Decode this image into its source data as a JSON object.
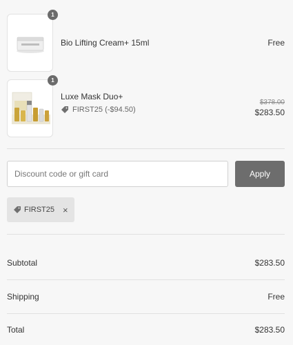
{
  "items": [
    {
      "name": "Bio Lifting Cream+ 15ml",
      "quantity": "1",
      "price": "Free",
      "image_icon": "cream-jar-thumbnail"
    },
    {
      "name": "Luxe Mask Duo+",
      "quantity": "1",
      "discount_label": "FIRST25 (-$94.50)",
      "original_price": "$378.00",
      "price": "$283.50",
      "image_icon": "mask-kit-thumbnail"
    }
  ],
  "discount": {
    "placeholder": "Discount code or gift card",
    "value": "",
    "apply_label": "Apply",
    "applied_code": "FIRST25",
    "remove_icon": "×"
  },
  "summary": {
    "subtotal_label": "Subtotal",
    "subtotal_value": "$283.50",
    "shipping_label": "Shipping",
    "shipping_value": "Free",
    "total_label": "Total",
    "total_value": "$283.50"
  },
  "colors": {
    "background": "#f7f7f7",
    "apply_button": "#6d6d6d",
    "chip_background": "#e4e4e4",
    "badge": "#6b6b6b"
  }
}
